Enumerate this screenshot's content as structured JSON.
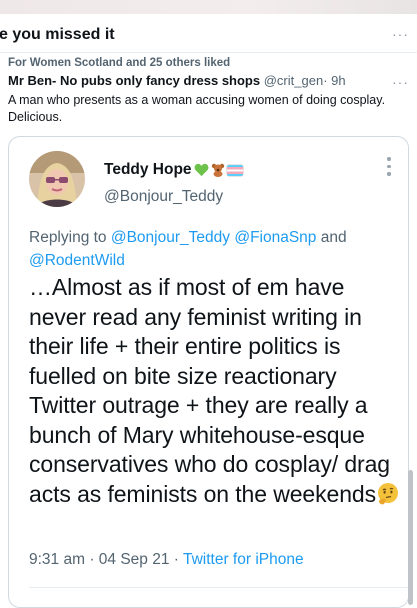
{
  "header": {
    "section_title": "e you missed it",
    "more_label": "···"
  },
  "tweet": {
    "liked_by": "For Women Scotland and 25 others liked",
    "author_name": "Mr Ben- No pubs only fancy dress shops",
    "author_handle": "@crit_gen",
    "time": "· 9h",
    "more_label": "···",
    "text": "A man who presents as a woman accusing women of doing cosplay. Delicious."
  },
  "quoted": {
    "display_name": "Teddy Hope",
    "handle": "@Bonjour_Teddy",
    "name_emojis": [
      "green-heart",
      "teddy-bear",
      "transgender-flag"
    ],
    "replying_prefix": "Replying to",
    "replying_to": [
      "@Bonjour_Teddy",
      "@FionaSnp",
      "@RodentWild"
    ],
    "replying_and": "and",
    "body": "…Almost as if most of em have never read any feminist writing in their life + their entire politics is fuelled on bite size reactionary Twitter outrage + they are really a bunch of Mary whitehouse-esque conservatives who do cosplay/ drag acts as feminists on the weekends",
    "body_emoji": "thinking-face",
    "time": "9:31 am",
    "date": "04 Sep 21",
    "source": "Twitter for iPhone",
    "separator": " · "
  },
  "colors": {
    "accent": "#1d9bf0",
    "secondary_text": "#536471",
    "primary_text": "#0f1419",
    "border": "#cfd9de"
  }
}
